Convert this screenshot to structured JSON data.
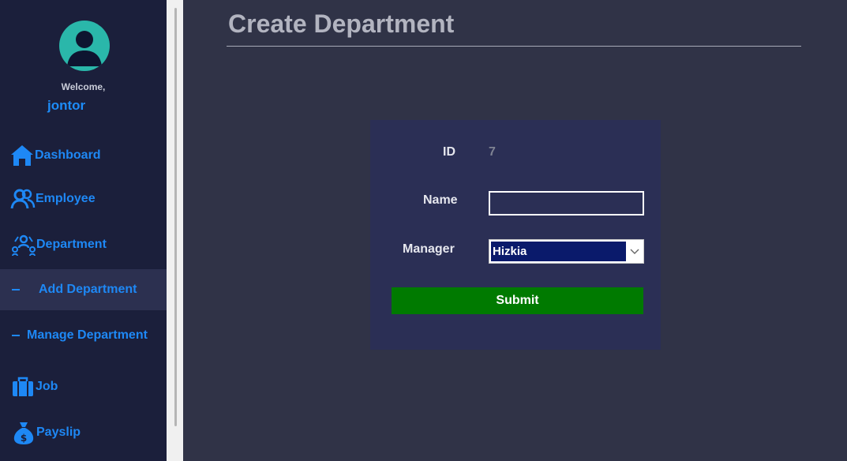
{
  "sidebar": {
    "welcome": "Welcome,",
    "username": "jontor",
    "items": [
      {
        "label": "Dashboard",
        "icon": "home-icon"
      },
      {
        "label": "Employee",
        "icon": "users-icon"
      },
      {
        "label": "Department",
        "icon": "org-icon"
      },
      {
        "label": "Add Department",
        "icon": "dash-icon"
      },
      {
        "label": "Manage Department",
        "icon": "dash-icon"
      },
      {
        "label": "Job",
        "icon": "briefcase-icon"
      },
      {
        "label": "Payslip",
        "icon": "money-bag-icon"
      }
    ],
    "active_item": "Add Department"
  },
  "page": {
    "title": "Create Department"
  },
  "form": {
    "id_label": "ID",
    "id_value": "7",
    "name_label": "Name",
    "name_value": "",
    "manager_label": "Manager",
    "manager_value": "Hizkia",
    "submit_label": "Submit"
  },
  "colors": {
    "sidebar_bg": "#1b1f3b",
    "accent": "#1e88f5",
    "main_bg": "#303347",
    "card_bg": "#2b2f55",
    "submit_bg": "#007a00",
    "avatar": "#2ab7aa"
  }
}
